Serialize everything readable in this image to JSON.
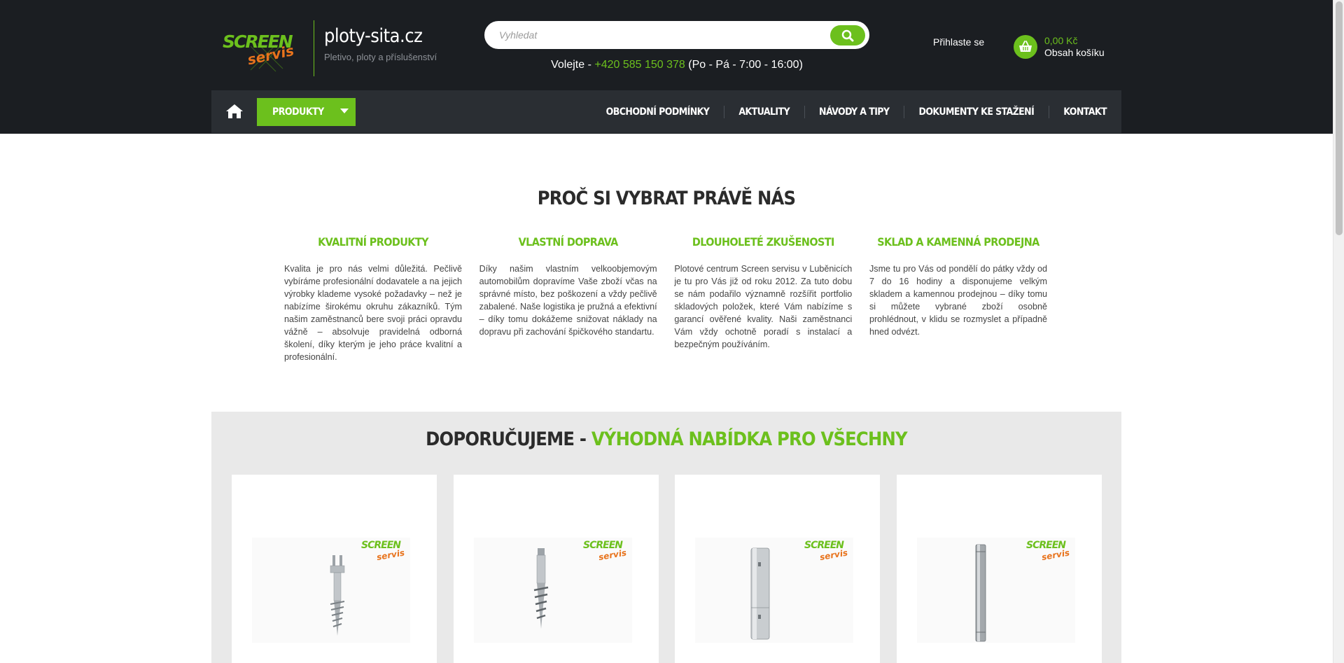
{
  "header": {
    "site_title": "ploty-sita.cz",
    "site_subtitle": "Pletivo, ploty a příslušenství",
    "logo_top": "SCREEN",
    "logo_bottom": "servis",
    "search_placeholder": "Vyhledat",
    "phone_prefix": "Volejte - ",
    "phone_number": "+420 585 150 378",
    "phone_hours": " (Po - Pá - 7:00 - 16:00)",
    "login": "Přihlaste se",
    "cart_price": "0,00 Kč",
    "cart_label": "Obsah košíku"
  },
  "nav": {
    "products": "PRODUKTY",
    "items": [
      "OBCHODNÍ PODMÍNKY",
      "AKTUALITY",
      "NÁVODY A TIPY",
      "DOKUMENTY KE STAŽENÍ",
      "KONTAKT"
    ]
  },
  "why": {
    "title": "PROČ SI VYBRAT PRÁVĚ NÁS",
    "features": [
      {
        "title": "KVALITNÍ PRODUKTY",
        "text": "Kvalita je pro nás velmi důležitá. Pečlivě vybíráme profesionální dodavatele a na jejich výrobky klademe vysoké požadavky – než je nabízíme širokému okruhu zákazníků. Tým našim zaměstnanců bere svoji práci opravdu vážně – absolvuje pravidelná odborná školení, díky kterým je jeho práce kvalitní a profesionální."
      },
      {
        "title": "VLASTNÍ DOPRAVA",
        "text": "Díky našim vlastním velkoobjemovým automobilům dopravíme Vaše zboží včas na správné místo, bez poškození a vždy pečlivě zabalené. Naše logistika je pružná a efektivní – díky tomu dokážeme snižovat náklady na dopravu při zachování špičkového standartu."
      },
      {
        "title": "DLOUHOLETÉ ZKUŠENOSTI",
        "text": "Plotové centrum Screen servisu v Luběnicích je tu pro Vás již od roku 2012. Za tuto dobu se nám podařilo významně rozšířit portfolio skladových položek, které Vám nabízíme s garancí ověřené kvality. Naši zaměstnanci Vám vždy ochotně poradí s instalací a bezpečným používáním."
      },
      {
        "title": "SKLAD A KAMENNÁ PRODEJNA",
        "text": "Jsme tu pro Vás od pondělí do pátky vždy od 7 do 16 hodiny a disponujeme velkým skladem a kamennou prodejnou – díky tomu si můžete vybrané zboží osobně prohlédnout, v klidu se rozmyslet a případně hned odvézt."
      }
    ]
  },
  "recommended": {
    "title_main": "DOPORUČUJEME - ",
    "title_accent": "VÝHODNÁ NABÍDKA PRO VŠECHNY",
    "watermark_top": "SCREEN",
    "watermark_bottom": "servis",
    "products": [
      {
        "image": "ground-screw-u-head"
      },
      {
        "image": "ground-screw-narrow"
      },
      {
        "image": "ground-screw-tube"
      },
      {
        "image": "ground-screw-long-tube"
      }
    ]
  },
  "colors": {
    "accent": "#6cc01d",
    "header_bg": "#1b1e22",
    "nav_bg": "#2a2e33",
    "section_bg": "#e9e9e9",
    "logo_orange": "#e8731c"
  }
}
